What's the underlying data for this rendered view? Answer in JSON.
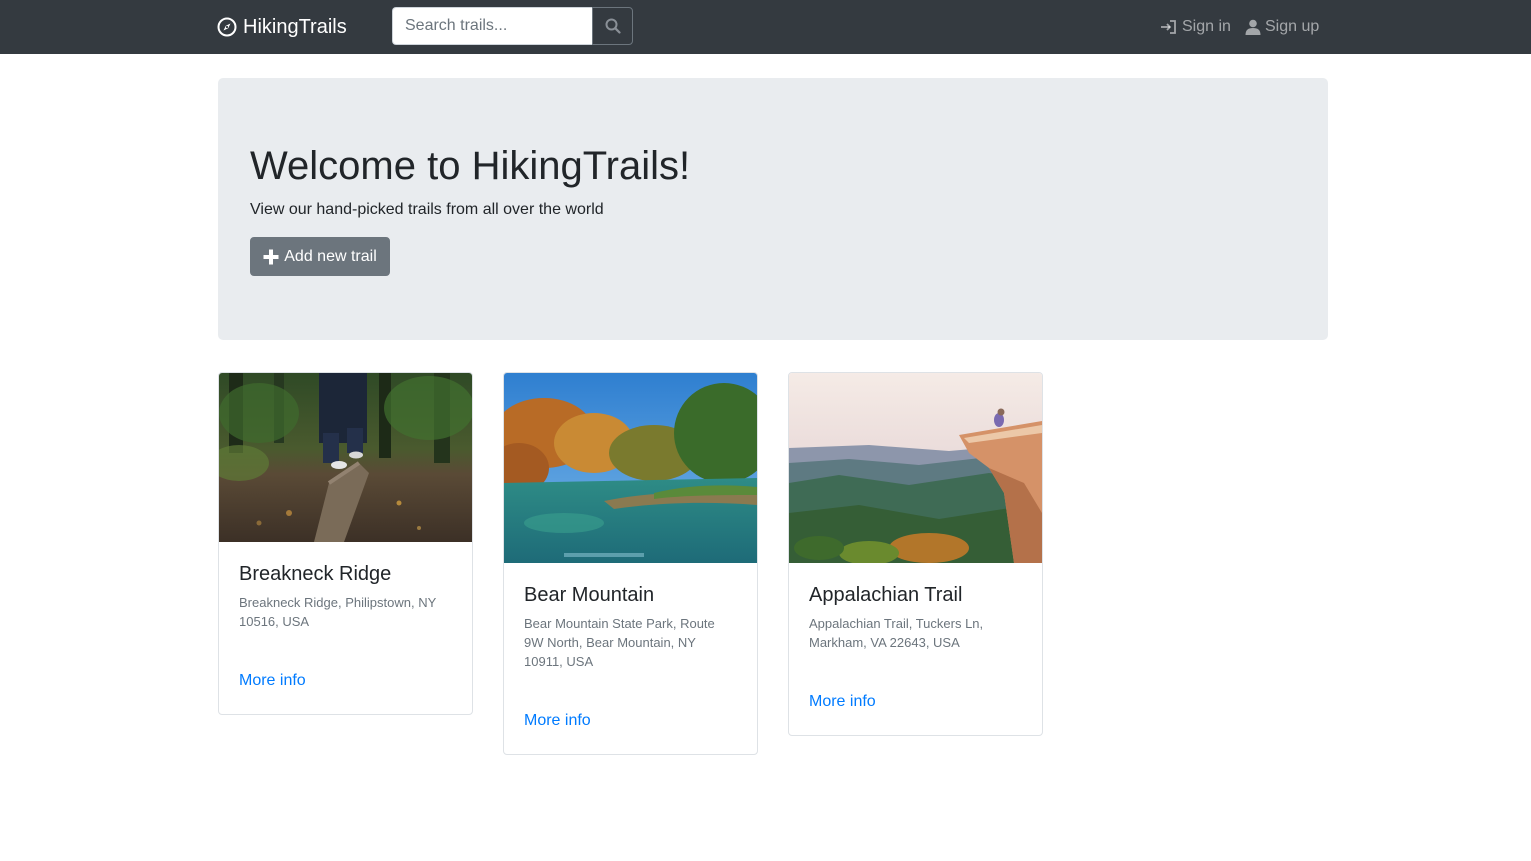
{
  "navbar": {
    "brand": "HikingTrails",
    "search_placeholder": "Search trails...",
    "signin": "Sign in",
    "signup": "Sign up"
  },
  "jumbotron": {
    "title": "Welcome to HikingTrails!",
    "subtitle": "View our hand-picked trails from all over the world",
    "add_button": "Add new trail"
  },
  "trails": [
    {
      "name": "Breakneck Ridge",
      "address": "Breakneck Ridge, Philipstown, NY 10516, USA",
      "link": "More info"
    },
    {
      "name": "Bear Mountain",
      "address": "Bear Mountain State Park, Route 9W North, Bear Mountain, NY 10911, USA",
      "link": "More info"
    },
    {
      "name": "Appalachian Trail",
      "address": "Appalachian Trail, Tuckers Ln, Markham, VA 22643, USA",
      "link": "More info"
    }
  ],
  "colors": {
    "navbar": "#343a40",
    "jumbotron": "#e9ecef",
    "secondary_button": "#6c757d",
    "link": "#007bff"
  },
  "icons": [
    "compass-icon",
    "search-icon",
    "sign-in-icon",
    "user-icon",
    "plus-icon"
  ]
}
